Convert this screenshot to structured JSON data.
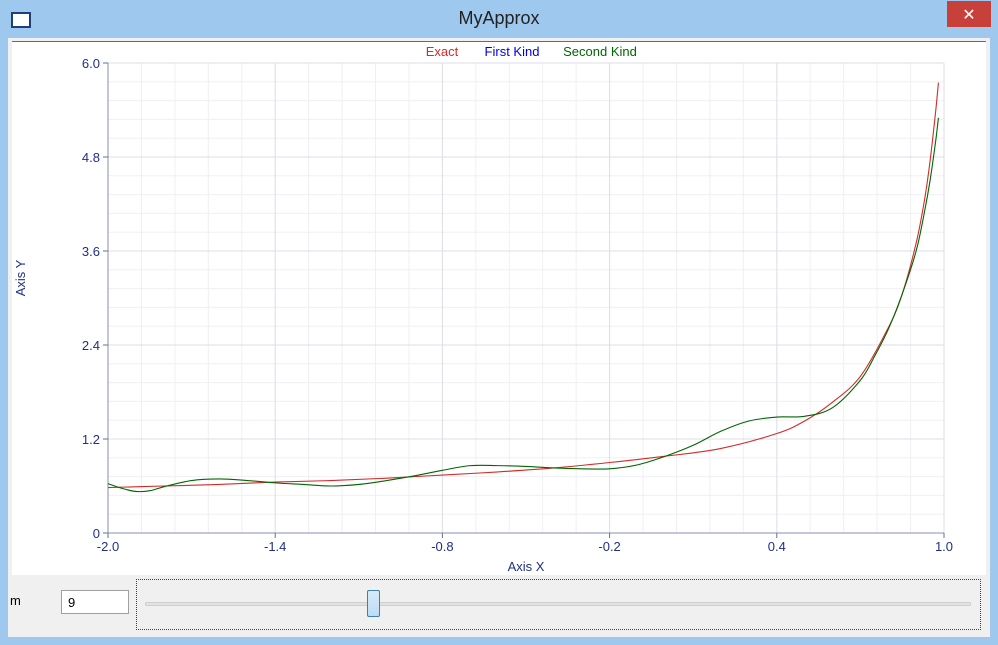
{
  "window": {
    "title": "MyApprox",
    "close_glyph": "✕",
    "app_icon": "window-icon",
    "close_icon": "close-icon"
  },
  "controls": {
    "m_label": "m",
    "m_value": "9",
    "slider": {
      "min": 1,
      "max": 30,
      "value": 9
    }
  },
  "colors": {
    "exact": "#d42a2a",
    "first_kind": "#0000ee",
    "second_kind": "#006600",
    "axis_text": "#1f2f8a",
    "grid_major": "#dcdde8",
    "grid_minor": "#f0f0f4"
  },
  "chart_data": {
    "type": "line",
    "title": "",
    "xlabel": "Axis X",
    "ylabel": "Axis Y",
    "xlim": [
      -2.0,
      1.0
    ],
    "ylim": [
      0,
      6.0
    ],
    "xticks": [
      -2.0,
      -1.4,
      -0.8,
      -0.2,
      0.4,
      1.0
    ],
    "xtick_labels": [
      "-2.0",
      "-1.4",
      "-0.8",
      "-0.2",
      "0.4",
      "1.0"
    ],
    "yticks": [
      0,
      1.2,
      2.4,
      3.6,
      4.8,
      6.0
    ],
    "ytick_labels": [
      "0",
      "1.2",
      "2.4",
      "3.6",
      "4.8",
      "6.0"
    ],
    "grid": true,
    "legend_position": "top-center",
    "series": [
      {
        "name": "Exact",
        "color": "#d42a2a",
        "x": [
          -2.0,
          -1.8,
          -1.6,
          -1.4,
          -1.2,
          -1.0,
          -0.8,
          -0.6,
          -0.4,
          -0.2,
          0.0,
          0.2,
          0.4,
          0.5,
          0.6,
          0.7,
          0.8,
          0.85,
          0.9,
          0.93,
          0.95,
          0.97,
          0.98
        ],
        "y": [
          0.58,
          0.6,
          0.62,
          0.65,
          0.67,
          0.7,
          0.74,
          0.78,
          0.83,
          0.9,
          0.98,
          1.08,
          1.27,
          1.43,
          1.67,
          2.0,
          2.62,
          3.05,
          3.7,
          4.25,
          4.75,
          5.38,
          5.75
        ]
      },
      {
        "name": "First Kind",
        "color": "#0000ee",
        "x": [],
        "y": []
      },
      {
        "name": "Second Kind",
        "color": "#006600",
        "x": [
          -2.0,
          -1.95,
          -1.9,
          -1.85,
          -1.8,
          -1.7,
          -1.6,
          -1.5,
          -1.4,
          -1.3,
          -1.2,
          -1.1,
          -1.0,
          -0.9,
          -0.8,
          -0.7,
          -0.6,
          -0.5,
          -0.4,
          -0.3,
          -0.2,
          -0.1,
          0.0,
          0.1,
          0.2,
          0.3,
          0.4,
          0.5,
          0.6,
          0.7,
          0.75,
          0.8,
          0.85,
          0.9,
          0.93,
          0.95,
          0.97,
          0.98
        ],
        "y": [
          0.63,
          0.57,
          0.53,
          0.54,
          0.59,
          0.67,
          0.69,
          0.67,
          0.64,
          0.62,
          0.6,
          0.62,
          0.67,
          0.73,
          0.8,
          0.86,
          0.86,
          0.85,
          0.83,
          0.82,
          0.82,
          0.87,
          0.98,
          1.12,
          1.3,
          1.43,
          1.48,
          1.49,
          1.6,
          1.95,
          2.25,
          2.6,
          3.05,
          3.6,
          4.1,
          4.5,
          5.0,
          5.3
        ]
      }
    ]
  }
}
